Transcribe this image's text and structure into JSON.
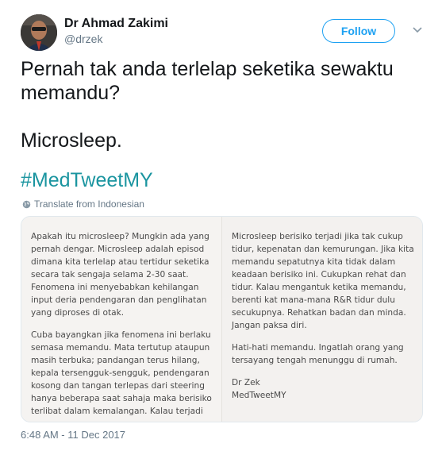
{
  "author": {
    "display_name": "Dr Ahmad Zakimi",
    "handle": "@drzek"
  },
  "follow_label": "Follow",
  "tweet": {
    "line1": "Pernah tak anda terlelap seketika sewaktu memandu?",
    "line2": "Microsleep.",
    "hashtag": "#MedTweetMY"
  },
  "translate_label": "Translate from Indonesian",
  "image_text": {
    "left_p1": "Apakah itu microsleep? Mungkin ada yang pernah dengar. Microsleep adalah episod dimana kita terlelap atau tertidur seketika secara tak sengaja selama 2-30 saat. Fenomena ini menyebabkan kehilangan input deria pendengaran dan penglihatan yang diproses di otak.",
    "left_p2": "Cuba bayangkan jika fenomena ini berlaku semasa memandu. Mata tertutup ataupun masih terbuka; pandangan terus hilang, kepala tersengguk-sengguk, pendengaran kosong dan tangan terlepas dari steering hanya beberapa saat sahaja maka berisiko terlibat dalam kemalangan. Kalau terjadi",
    "right_p1": "Microsleep berisiko terjadi jika tak cukup tidur, kepenatan dan kemurungan. Jika kita memandu sepatutnya kita tidak dalam keadaan berisiko ini. Cukupkan rehat dan tidur. Kalau mengantuk ketika memandu, berenti kat mana-mana R&R tidur dulu secukupnya. Rehatkan badan dan minda. Jangan paksa diri.",
    "right_p2": "Hati-hati memandu. Ingatlah orang yang tersayang tengah menunggu di rumah.",
    "right_sig1": "Dr Zek",
    "right_sig2": "MedTweetMY"
  },
  "timestamp": "6:48 AM - 11 Dec 2017",
  "colors": {
    "accent": "#1da1f2",
    "hashtag": "#1b95a0",
    "muted": "#657786"
  }
}
